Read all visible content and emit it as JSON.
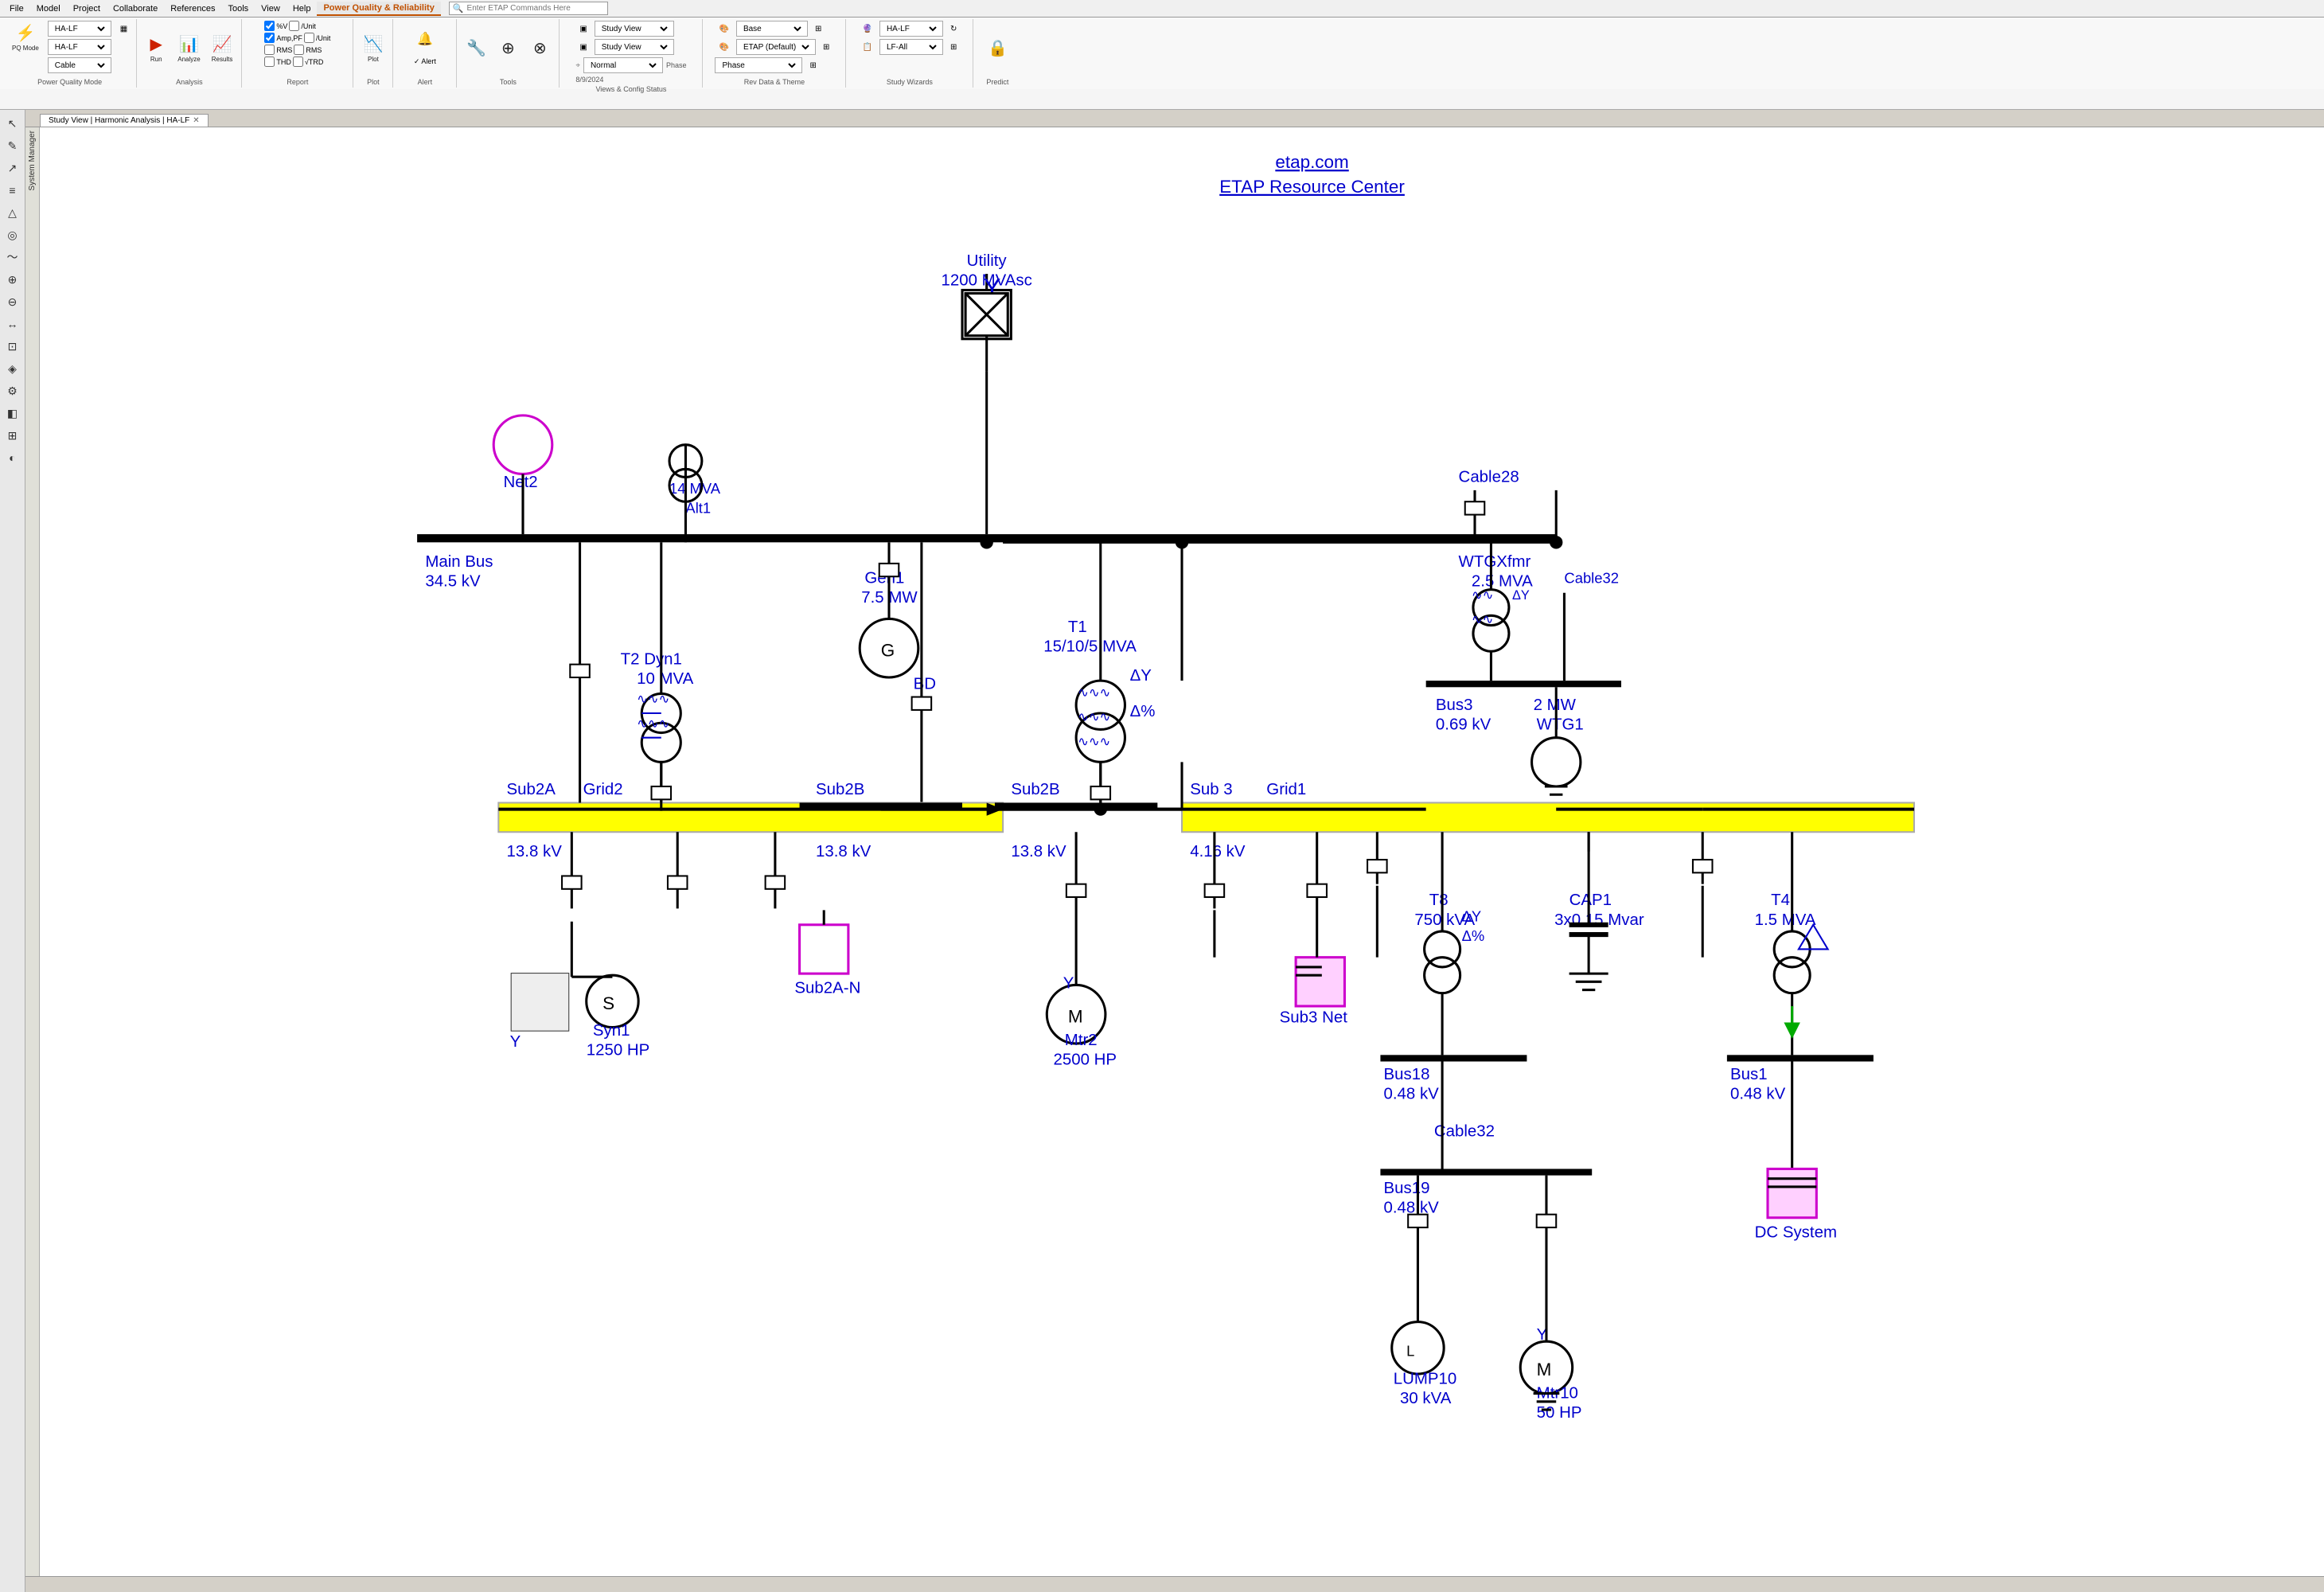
{
  "app": {
    "title": "ETAP",
    "active_tab": "Power Quality & Reliability"
  },
  "menu": {
    "items": [
      "File",
      "Model",
      "Project",
      "Collaborate",
      "References",
      "Tools",
      "View",
      "Help",
      "Power Quality & Reliability"
    ],
    "search_placeholder": "Enter ETAP Commands Here"
  },
  "ribbon": {
    "tabs": [
      {
        "label": "File"
      },
      {
        "label": "Model"
      },
      {
        "label": "Project"
      },
      {
        "label": "Collaborate"
      },
      {
        "label": "References"
      },
      {
        "label": "Tools"
      },
      {
        "label": "View"
      },
      {
        "label": "Help"
      },
      {
        "label": "Power Quality & Reliability",
        "active": true
      }
    ],
    "groups": {
      "mode": {
        "label": "Power Quality Mode",
        "study_case": "HA-LF",
        "analysis_type": "HA-LF",
        "cable_type": "Cable"
      },
      "analysis": {
        "label": "Analysis"
      },
      "report": {
        "label": "Report",
        "options": [
          "%V",
          "/Unit",
          "Amp,PF",
          "/Unit",
          "RMS",
          "RMS",
          "THD",
          "√TRD"
        ]
      },
      "plot": {
        "label": "Plot"
      },
      "alert": {
        "label": "Alert"
      },
      "tools": {
        "label": "Tools"
      },
      "views": {
        "label": "Views & Config Status",
        "view1": "Study View",
        "view2": "Study View",
        "phase": "Normal",
        "date": "8/9/2024"
      },
      "rev": {
        "label": "Rev Data & Theme",
        "base": "Base",
        "theme": "ETAP (Default)",
        "phase_dropdown": "Phase"
      },
      "study_wizards": {
        "label": "Study Wizards",
        "case": "HA-LF",
        "lf": "LF-All"
      },
      "predict": {
        "label": "Predict"
      }
    }
  },
  "tabs": [
    {
      "label": "Study View | Harmonic Analysis | HA-LF",
      "active": true
    }
  ],
  "left_tools": [
    {
      "icon": "↖",
      "name": "select"
    },
    {
      "icon": "✏",
      "name": "edit"
    },
    {
      "icon": "↗",
      "name": "line"
    },
    {
      "icon": "⚡",
      "name": "bus"
    },
    {
      "icon": "△",
      "name": "triangle"
    },
    {
      "icon": "◎",
      "name": "circle"
    },
    {
      "icon": "≋",
      "name": "wave"
    },
    {
      "icon": "⊕",
      "name": "plus"
    },
    {
      "icon": "⊘",
      "name": "no"
    },
    {
      "icon": "↔",
      "name": "arrow"
    },
    {
      "icon": "⊡",
      "name": "box"
    },
    {
      "icon": "◈",
      "name": "diamond"
    },
    {
      "icon": "⚙",
      "name": "gear"
    },
    {
      "icon": "◧",
      "name": "half"
    },
    {
      "icon": "⊞",
      "name": "grid"
    },
    {
      "icon": "◐",
      "name": "half-circle"
    }
  ],
  "diagram": {
    "title_link": "etap.com",
    "subtitle_link": "ETAP Resource Center",
    "components": {
      "utility": {
        "label": "Utility",
        "value": "1200 MVAsc"
      },
      "net2": {
        "label": "Net2"
      },
      "alt1": {
        "label": "14 MVA\nAlt1"
      },
      "main_bus": {
        "label": "Main Bus",
        "value": "34.5 kV"
      },
      "gen1": {
        "label": "Gen1",
        "value": "7.5 MW"
      },
      "t2": {
        "label": "T2  Dyn1",
        "value": "10 MVA"
      },
      "bd": {
        "label": "BD"
      },
      "t1": {
        "label": "T1",
        "value": "15/10/5 MVA"
      },
      "cable28": {
        "label": "Cable28"
      },
      "wtgxfmr": {
        "label": "WTGXfmr",
        "value": "2.5 MVA"
      },
      "bus3": {
        "label": "Bus3",
        "value": "0.69 kV"
      },
      "cable32": {
        "label": "Cable32"
      },
      "wtg1": {
        "label": "2 MW\nWTG1"
      },
      "sub2a": {
        "label": "Sub2A",
        "value": "13.8 kV"
      },
      "grid2": {
        "label": "Grid2"
      },
      "sub2b_1": {
        "label": "Sub2B",
        "value": "13.8 kV"
      },
      "sub2b_2": {
        "label": "Sub2B",
        "value": "13.8 kV"
      },
      "sub3": {
        "label": "Sub 3",
        "value": "4.16 kV"
      },
      "grid1": {
        "label": "Grid1"
      },
      "sub2a_n": {
        "label": "Sub2A-N"
      },
      "syn1": {
        "label": "Syn1",
        "value": "1250 HP"
      },
      "mtr2": {
        "label": "Mtr2",
        "value": "2500 HP"
      },
      "sub3_net": {
        "label": "Sub3 Net"
      },
      "t8": {
        "label": "T8",
        "value": "750 kVA"
      },
      "cap1": {
        "label": "CAP1",
        "value": "3x0.15 Mvar"
      },
      "t4": {
        "label": "T4",
        "value": "1.5 MVA"
      },
      "bus18": {
        "label": "Bus18",
        "value": "0.48 kV"
      },
      "bus1": {
        "label": "Bus1",
        "value": "0.48 kV"
      },
      "cable32b": {
        "label": "Cable32"
      },
      "bus19": {
        "label": "Bus19",
        "value": "0.48 kV"
      },
      "lump10": {
        "label": "LUMP10",
        "value": "30 kVA"
      },
      "mtr10": {
        "label": "Mtr10",
        "value": "50 HP"
      },
      "dc_system": {
        "label": "DC System"
      }
    }
  },
  "status_bar": {
    "text": ""
  }
}
